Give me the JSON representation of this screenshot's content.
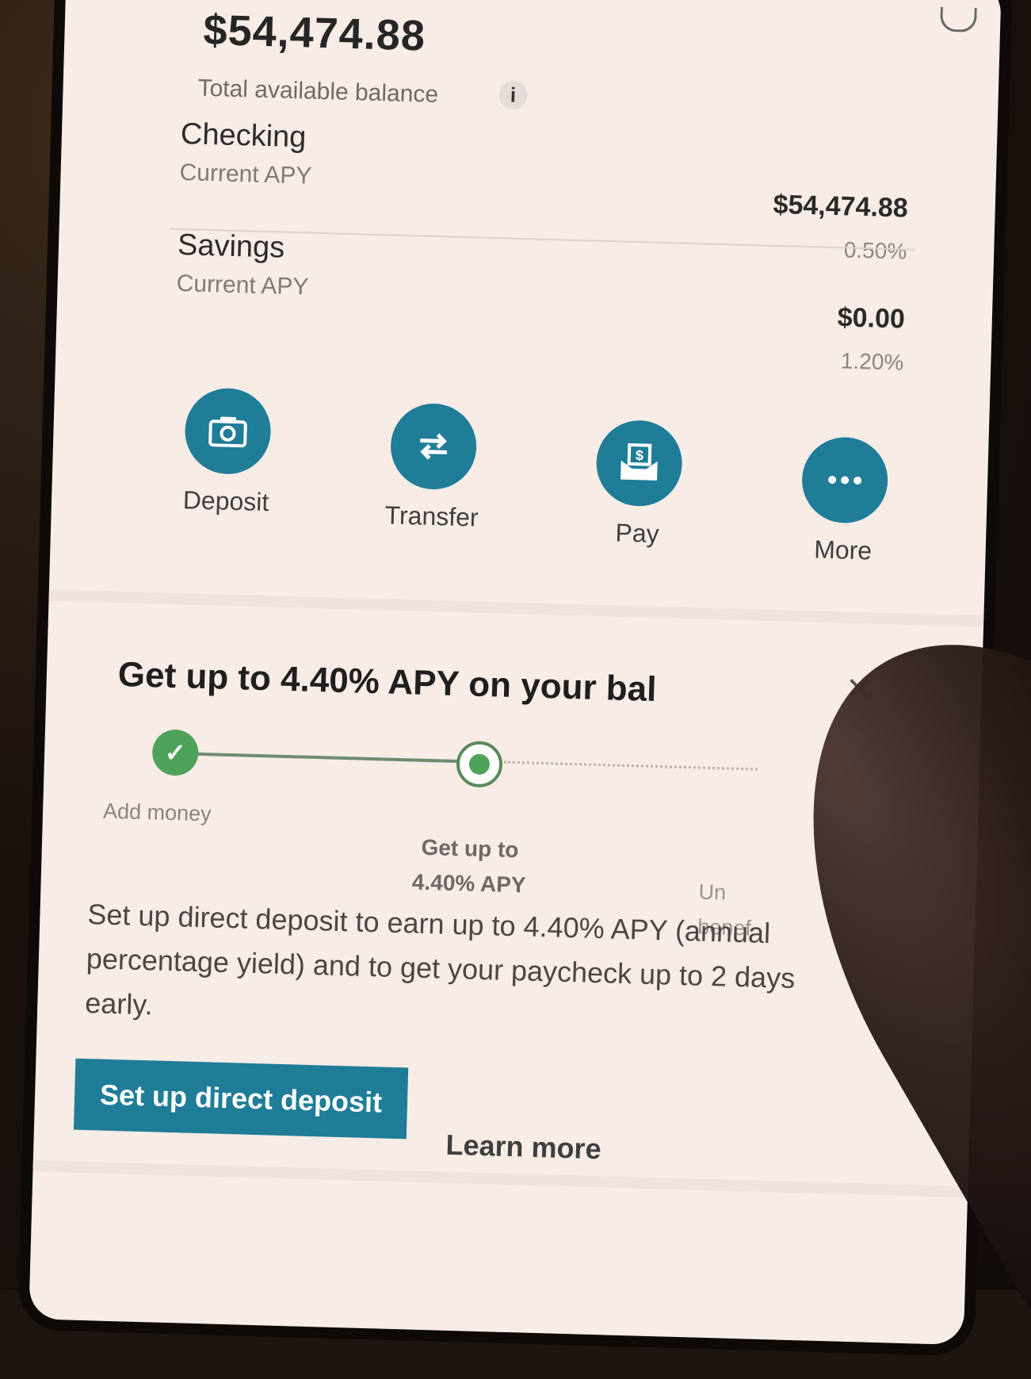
{
  "balance": {
    "total_amount": "$54,474.88",
    "total_label": "Total available balance",
    "info_glyph": "i"
  },
  "accounts": [
    {
      "name": "Checking",
      "apy_label": "Current APY",
      "balance": "$54,474.88",
      "apy": "0.50%"
    },
    {
      "name": "Savings",
      "apy_label": "Current APY",
      "balance": "$0.00",
      "apy": "1.20%"
    }
  ],
  "actions": [
    {
      "label": "Deposit",
      "icon": "camera-icon"
    },
    {
      "label": "Transfer",
      "icon": "transfer-arrows-icon"
    },
    {
      "label": "Pay",
      "icon": "bill-pay-icon"
    },
    {
      "label": "More",
      "icon": "more-dots-icon"
    }
  ],
  "promo": {
    "title": "Get up to 4.40% APY on your bal",
    "close_glyph": "×",
    "steps": [
      {
        "label": "Add money",
        "status": "done"
      },
      {
        "label_line1": "Get up to",
        "label_line2": "4.40% APY",
        "status": "current"
      },
      {
        "label_line1": "Un",
        "label_line2": "benef",
        "status": "todo"
      }
    ],
    "body": "Set up direct deposit to earn up to 4.40% APY (annual percentage yield) and to get your paycheck up to 2 days early.",
    "cta_label": "Set up direct deposit",
    "learn_more_label": "Learn more"
  },
  "colors": {
    "accent": "#1f7d98",
    "success": "#4fa25a",
    "screen_bg": "#f8ece7"
  }
}
